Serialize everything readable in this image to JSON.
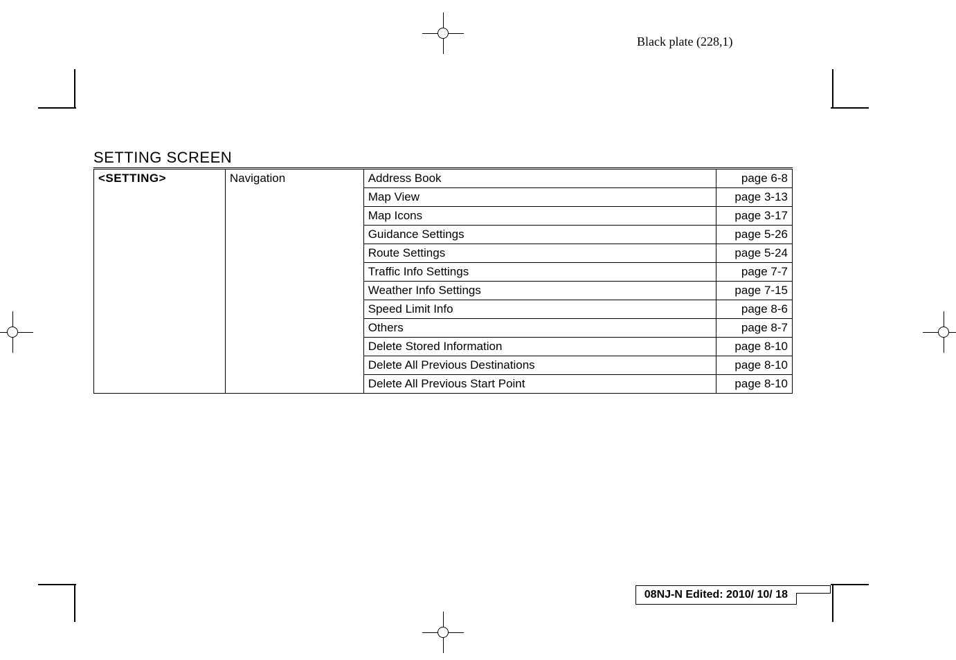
{
  "header": {
    "plate_text": "Black plate (228,1)"
  },
  "section": {
    "title": "SETTING SCREEN"
  },
  "table": {
    "col1": "<SETTING>",
    "col2": "Navigation",
    "rows": [
      {
        "label": "Address Book",
        "page": "page 6-8"
      },
      {
        "label": "Map View",
        "page": "page 3-13"
      },
      {
        "label": "Map Icons",
        "page": "page 3-17"
      },
      {
        "label": "Guidance Settings",
        "page": "page 5-26"
      },
      {
        "label": "Route Settings",
        "page": "page 5-24"
      },
      {
        "label": "Traffic Info Settings",
        "page": "page 7-7"
      },
      {
        "label": "Weather Info Settings",
        "page": "page 7-15"
      },
      {
        "label": "Speed Limit Info",
        "page": "page 8-6"
      },
      {
        "label": "Others",
        "page": "page 8-7"
      },
      {
        "label": "Delete Stored Information",
        "page": "page 8-10"
      },
      {
        "label": "Delete All Previous Destinations",
        "page": "page 8-10"
      },
      {
        "label": "Delete All Previous Start Point",
        "page": "page 8-10"
      }
    ]
  },
  "footer": {
    "text": "08NJ-N Edited:  2010/ 10/ 18"
  }
}
